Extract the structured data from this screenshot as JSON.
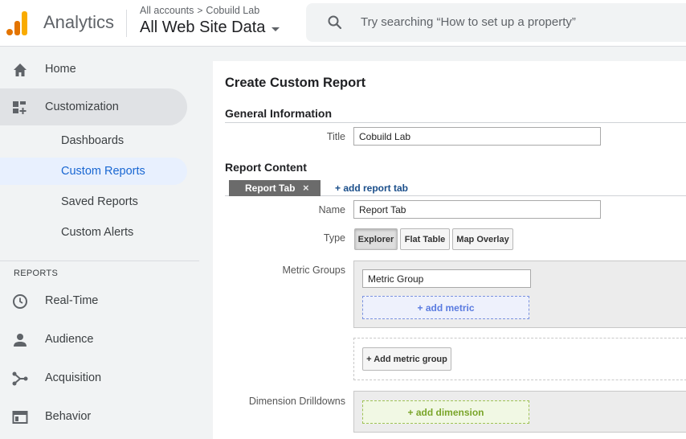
{
  "header": {
    "app_title": "Analytics",
    "breadcrumb": {
      "account": "All accounts",
      "separator": ">",
      "property": "Cobuild Lab"
    },
    "view_name": "All Web Site Data",
    "search_placeholder": "Try searching “How to set up a property”"
  },
  "sidebar": {
    "home": "Home",
    "customization": "Customization",
    "sub_items": [
      "Dashboards",
      "Custom Reports",
      "Saved Reports",
      "Custom Alerts"
    ],
    "selected_sub_item": "Custom Reports",
    "reports_section": "REPORTS",
    "report_items": [
      "Real-Time",
      "Audience",
      "Acquisition",
      "Behavior"
    ]
  },
  "main": {
    "page_title": "Create Custom Report",
    "general_section": "General Information",
    "title_label": "Title",
    "title_value": "Cobuild Lab",
    "report_content_section": "Report Content",
    "tab_name": "Report Tab",
    "tab_close": "×",
    "add_tab": "+ add report tab",
    "name_label": "Name",
    "name_value": "Report Tab",
    "type_label": "Type",
    "type_options": [
      "Explorer",
      "Flat Table",
      "Map Overlay"
    ],
    "type_selected": "Explorer",
    "metric_groups_label": "Metric Groups",
    "metric_group_value": "Metric Group",
    "add_metric": "+ add metric",
    "add_metric_group": "+ Add metric group",
    "dimension_label": "Dimension Drilldowns",
    "add_dimension": "+ add dimension"
  },
  "colors": {
    "accent_blue": "#1967d2",
    "logo_orange": "#e37400",
    "logo_yellow": "#f9ab00"
  }
}
